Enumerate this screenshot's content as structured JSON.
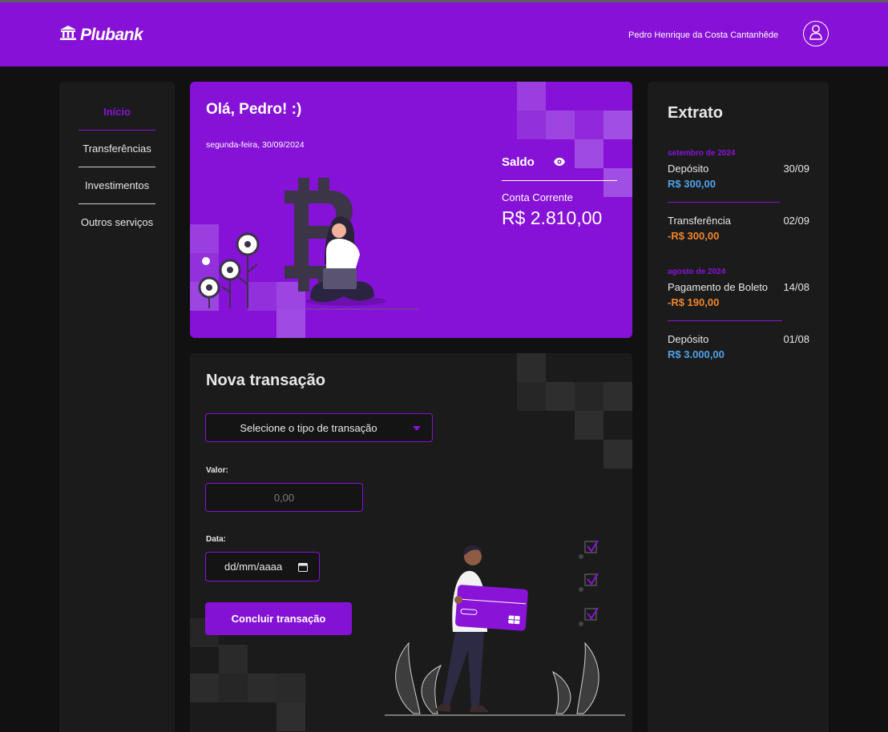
{
  "header": {
    "brand": "Plubank",
    "brand_icon": "bank-icon",
    "user_name": "Pedro Henrique da Costa Cantanhêde",
    "avatar_icon": "user-icon",
    "color": "#8711d6"
  },
  "sidebar": {
    "items": [
      {
        "label": "Início",
        "active": true
      },
      {
        "label": "Transferências",
        "active": false
      },
      {
        "label": "Investimentos",
        "active": false
      },
      {
        "label": "Outros serviços",
        "active": false
      }
    ]
  },
  "hero": {
    "greeting": "Olá, Pedro! :)",
    "date": "segunda-feira, 30/09/2024",
    "balance_label": "Saldo",
    "eye_icon": "eye-icon",
    "account_type": "Conta Corrente",
    "balance": "R$ 2.810,00"
  },
  "form": {
    "title": "Nova transação",
    "select_value": "Selecione o tipo de transação",
    "value_label": "Valor:",
    "value_placeholder": "0,00",
    "date_label": "Data:",
    "date_placeholder": "dd/mm/aaaa",
    "submit_label": "Concluir transação"
  },
  "extrato": {
    "title": "Extrato",
    "months": [
      "setembro de 2024",
      "agosto de 2024"
    ],
    "transactions": [
      {
        "description": "Depósito",
        "date": "30/09",
        "amount": "R$ 300,00",
        "type": "in"
      },
      {
        "description": "Transferência",
        "date": "02/09",
        "amount": "-R$ 300,00",
        "type": "out"
      },
      {
        "description": "Pagamento de Boleto",
        "date": "14/08",
        "amount": "-R$ 190,00",
        "type": "out"
      },
      {
        "description": "Depósito",
        "date": "01/08",
        "amount": "R$ 3.000,00",
        "type": "in"
      }
    ]
  },
  "colors": {
    "accent": "#8412d5",
    "income": "#4fa3e8",
    "expense": "#f0862a",
    "background": "#111111",
    "card": "#1b1b1b"
  }
}
